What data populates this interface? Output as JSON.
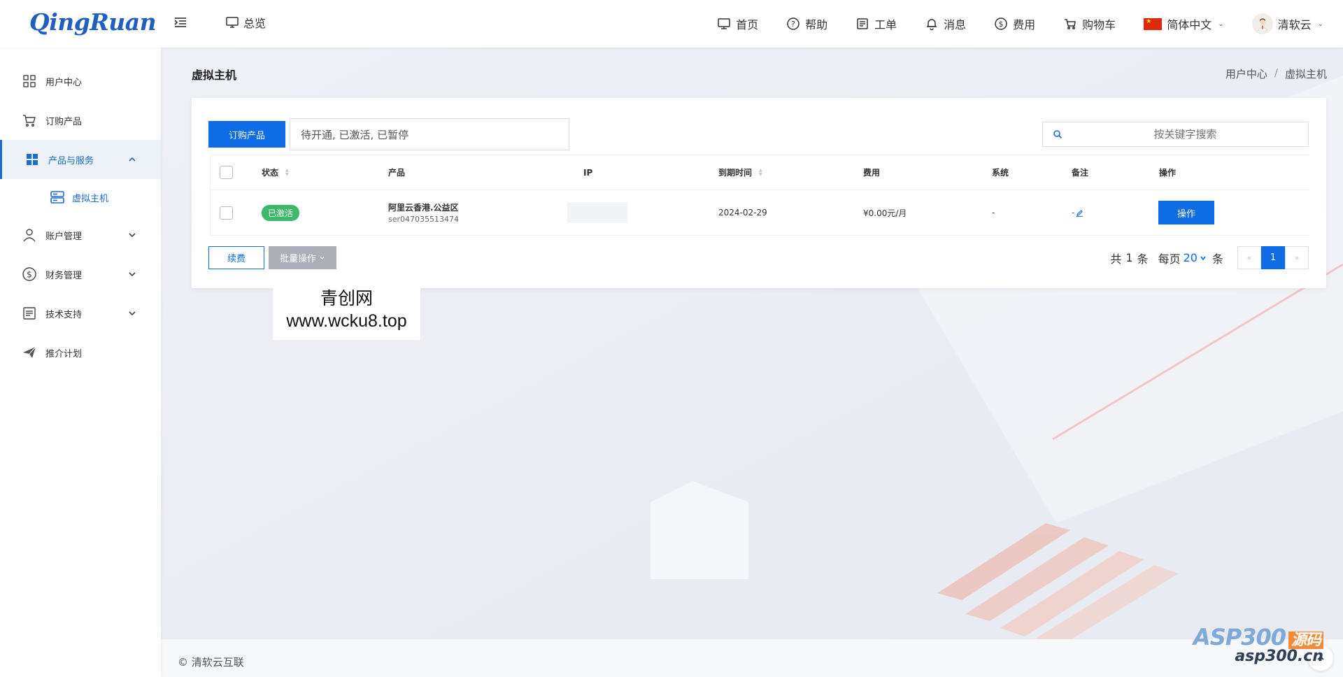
{
  "brand": {
    "logo_text": "QingRuan"
  },
  "topbar": {
    "overview_label": "总览",
    "nav": [
      {
        "label": "首页",
        "icon": "home-icon"
      },
      {
        "label": "帮助",
        "icon": "help-icon"
      },
      {
        "label": "工单",
        "icon": "ticket-icon"
      },
      {
        "label": "消息",
        "icon": "bell-icon"
      },
      {
        "label": "费用",
        "icon": "dollar-icon"
      },
      {
        "label": "购物车",
        "icon": "cart-icon"
      }
    ],
    "language": "简体中文",
    "user_name": "清软云"
  },
  "sidebar": {
    "items": [
      {
        "label": "用户中心",
        "icon": "grid-icon"
      },
      {
        "label": "订购产品",
        "icon": "cart-icon"
      },
      {
        "label": "产品与服务",
        "icon": "apps-icon"
      },
      {
        "label": "账户管理",
        "icon": "user-icon"
      },
      {
        "label": "财务管理",
        "icon": "dollar-icon"
      },
      {
        "label": "技术支持",
        "icon": "document-icon"
      },
      {
        "label": "推介计划",
        "icon": "paper-plane-icon"
      }
    ],
    "sub_item": {
      "label": "虚拟主机",
      "icon": "server-icon"
    }
  },
  "page": {
    "title": "虚拟主机",
    "breadcrumb": [
      "用户中心",
      "/",
      "虚拟主机"
    ]
  },
  "toolbar": {
    "order_button": "订购产品",
    "status_filter": "待开通, 已激活, 已暂停",
    "search_placeholder": "按关键字搜索"
  },
  "table": {
    "columns": [
      "状态",
      "产品",
      "IP",
      "到期时间",
      "费用",
      "系统",
      "备注",
      "操作"
    ],
    "rows": [
      {
        "status": "已激活",
        "product_name": "阿里云香港.公益区",
        "product_id": "ser047035513474",
        "expire": "2024-02-29",
        "fee": "¥0.00元/月",
        "system": "-",
        "note": "-",
        "action": "操作"
      }
    ]
  },
  "bottom": {
    "renew_button": "续费",
    "batch_button": "批量操作"
  },
  "pager": {
    "total_prefix": "共",
    "total": "1",
    "total_suffix": "条",
    "per_prefix": "每页",
    "per_page": "20",
    "per_suffix": "条",
    "prev": "«",
    "current": "1",
    "next": "»"
  },
  "watermark": {
    "line1": "青创网",
    "line2": "www.wcku8.top"
  },
  "footer": {
    "copyright": "© 清软云互联"
  },
  "asp_mark": {
    "main": "ASP300",
    "badge": "源码",
    "url": "asp300.cn"
  },
  "colors": {
    "primary": "#0e6ce6",
    "success": "#3eb86a",
    "logo": "#1f5fbf"
  }
}
